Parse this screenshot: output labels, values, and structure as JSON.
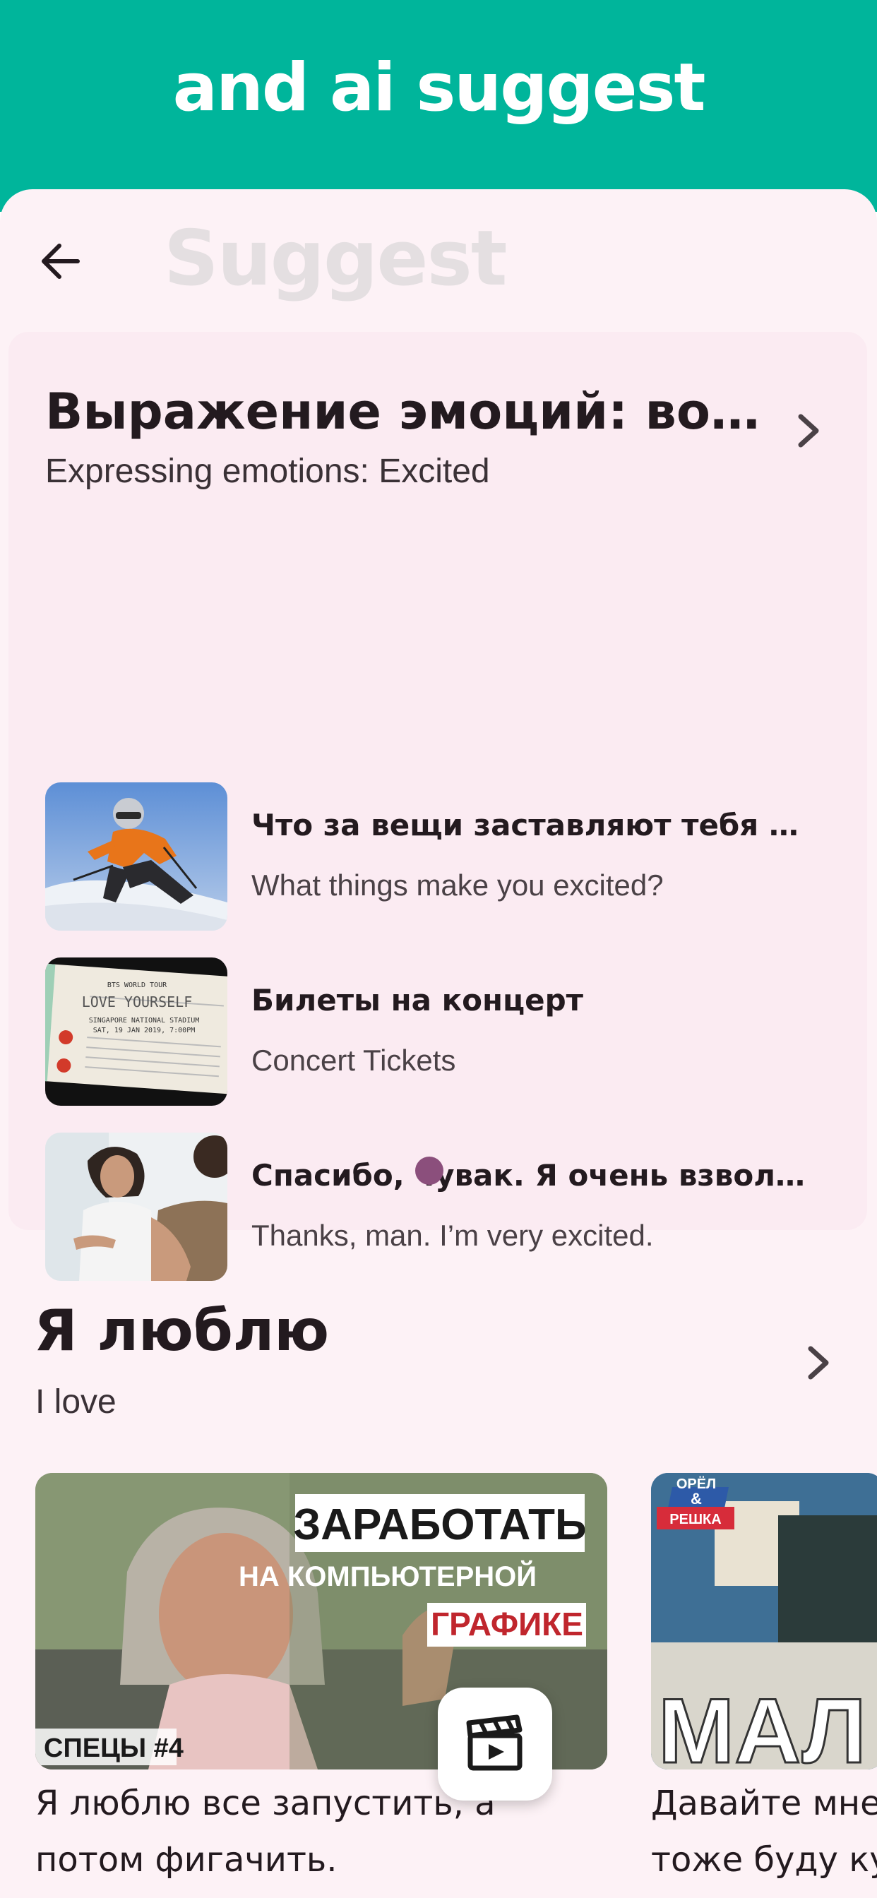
{
  "banner": {
    "title": "and ai suggest"
  },
  "header": {
    "title": "Suggest"
  },
  "featured": {
    "title": "Выражение эмоций: возбуждение",
    "subtitle": "Expressing emotions: Excited",
    "items": [
      {
        "ru": "Что за вещи заставляют тебя волноваться?",
        "en": "What things make you excited?",
        "image": "skier-photo"
      },
      {
        "ru": "Билеты на концерт",
        "en": "Concert Tickets",
        "image": "concert-tickets-photo"
      },
      {
        "ru": "Спасибо, чувак. Я очень взволнован.",
        "en": "Thanks, man. I’m very excited.",
        "image": "conversation-photo"
      }
    ]
  },
  "ticket_text": {
    "line1": "BTS WORLD TOUR",
    "line2": "LOVE YOURSELF",
    "line3": "SINGAPORE NATIONAL STADIUM",
    "line4": "SAT, 19 JAN 2019, 7:00PM"
  },
  "section": {
    "title": "Я люблю",
    "subtitle": "I love",
    "videos": [
      {
        "caption_line1": "Я люблю все запустить, а",
        "caption_line2": "потом фигачить.",
        "thumb_lines": [
          "ЗАРАБОТАТЬ",
          "НА КОМПЬЮТЕРНОЙ",
          "ГРАФИКЕ"
        ],
        "thumb_tag": "СПЕЦЫ #4"
      },
      {
        "caption_line1": "Давайте мне",
        "caption_line2": "тоже буду ку",
        "thumb_logo_top": "ОРЁЛ",
        "thumb_logo_amp": "&",
        "thumb_logo_bottom": "РЕШКА",
        "thumb_big": "МАЛ"
      }
    ]
  },
  "icons": {
    "back": "arrow-left-icon",
    "chevron": "chevron-right-icon",
    "fab": "clapperboard-icon"
  },
  "colors": {
    "banner": "#00b59b",
    "screen_bg": "#fdf2f6",
    "card_bg": "#fbebf2",
    "dot": "#8b4f7c"
  }
}
